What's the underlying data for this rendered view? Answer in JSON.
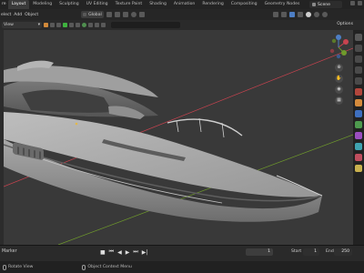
{
  "topbar": {
    "app_menu_fragment": "re",
    "workspace_tabs": [
      "Layout",
      "Modeling",
      "Sculpting",
      "UV Editing",
      "Texture Paint",
      "Shading",
      "Animation",
      "Rendering",
      "Compositing",
      "Geometry Nodes"
    ],
    "active_tab": "Layout",
    "scene_label": "Scene"
  },
  "header": {
    "menu_fragments": [
      "elect",
      "Add",
      "Object"
    ],
    "transform_orientation": "Global"
  },
  "view_header": {
    "view_menu": "View",
    "options_label": "Options"
  },
  "timeline": {
    "marker_label": "Marker",
    "current_frame": "1",
    "start_label": "Start",
    "start_value": "1",
    "end_label": "End",
    "end_value": "250"
  },
  "statusbar": {
    "left_hint": "Rotate View",
    "right_hint": "Object Context Menu"
  },
  "colors": {
    "viewport_bg": "#393939",
    "axis_red": "#c8434f",
    "axis_green": "#6f9a2c",
    "gizmo_blue": "#4d7ec4"
  }
}
